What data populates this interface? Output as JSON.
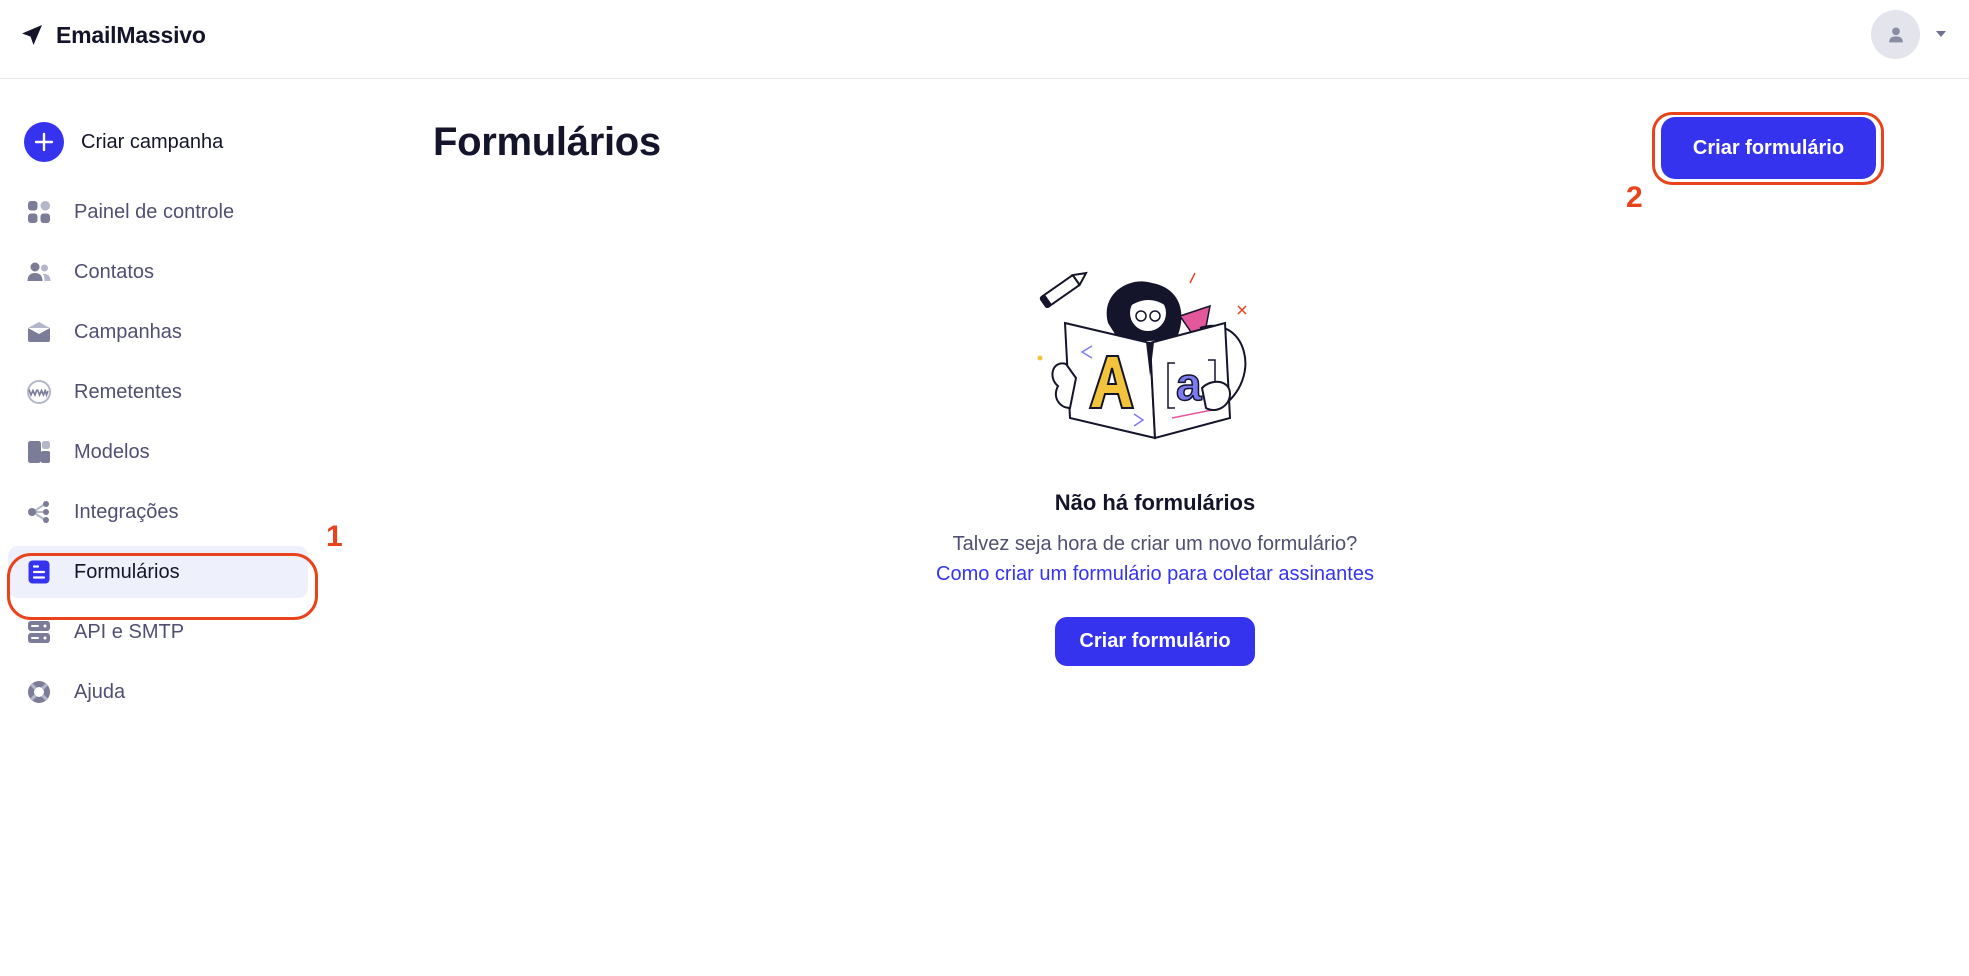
{
  "app": {
    "name": "EmailMassivo"
  },
  "header": {
    "avatar_icon": "user-icon",
    "menu_icon": "caret-down-icon"
  },
  "sidebar": {
    "create_label": "Criar campanha",
    "items": [
      {
        "label": "Painel de controle",
        "icon": "dashboard-icon",
        "active": false
      },
      {
        "label": "Contatos",
        "icon": "contacts-icon",
        "active": false
      },
      {
        "label": "Campanhas",
        "icon": "envelope-icon",
        "active": false
      },
      {
        "label": "Remetentes",
        "icon": "globe-www-icon",
        "active": false
      },
      {
        "label": "Modelos",
        "icon": "templates-icon",
        "active": false
      },
      {
        "label": "Integrações",
        "icon": "integrations-icon",
        "active": false
      },
      {
        "label": "Formulários",
        "icon": "form-icon",
        "active": true
      },
      {
        "label": "API e SMTP",
        "icon": "server-icon",
        "active": false
      },
      {
        "label": "Ajuda",
        "icon": "lifebuoy-icon",
        "active": false
      }
    ]
  },
  "main": {
    "title": "Formulários",
    "create_button": "Criar formulário",
    "empty": {
      "title": "Não há formulários",
      "subtitle": "Talvez seja hora de criar um novo formulário?",
      "link": "Como criar um formulário para coletar assinantes",
      "button": "Criar formulário"
    }
  },
  "annotations": [
    {
      "number": "1",
      "target": "Formulários"
    },
    {
      "number": "2",
      "target": "Criar formulário"
    }
  ],
  "colors": {
    "accent": "#3533ee",
    "annotation": "#e8431d",
    "active_bg": "#eef0fb",
    "nav_icon": "#7a7c98"
  }
}
